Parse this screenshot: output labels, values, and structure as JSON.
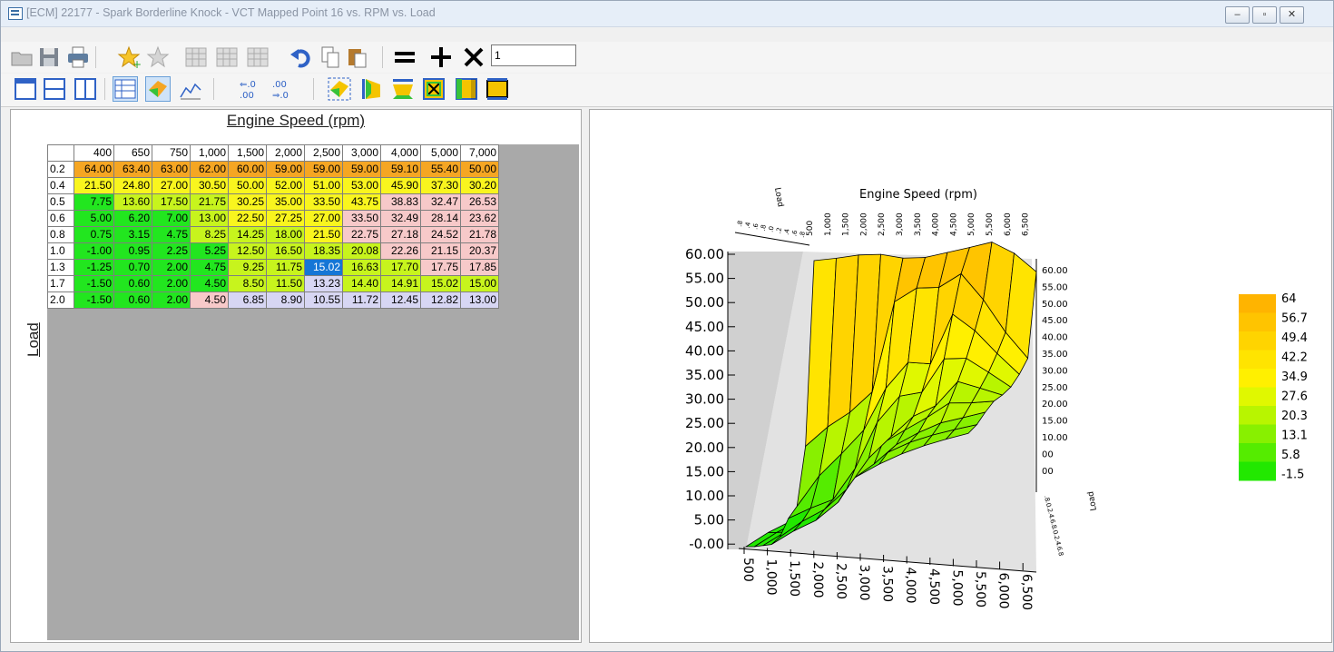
{
  "window": {
    "title": "[ECM] 22177 - Spark Borderline Knock - VCT Mapped Point 16 vs. RPM vs. Load"
  },
  "toolbar": {
    "multiplier_value": "1"
  },
  "table": {
    "x_axis_title": "Engine Speed (rpm)",
    "y_axis_title": "Load",
    "columns": [
      "400",
      "650",
      "750",
      "1,000",
      "1,500",
      "2,000",
      "2,500",
      "3,000",
      "4,000",
      "5,000",
      "7,000"
    ],
    "rows": [
      {
        "label": "0.2",
        "values": [
          "64.00",
          "63.40",
          "63.00",
          "62.00",
          "60.00",
          "59.00",
          "59.00",
          "59.00",
          "59.10",
          "55.40",
          "50.00"
        ]
      },
      {
        "label": "0.4",
        "values": [
          "21.50",
          "24.80",
          "27.00",
          "30.50",
          "50.00",
          "52.00",
          "51.00",
          "53.00",
          "45.90",
          "37.30",
          "30.20"
        ]
      },
      {
        "label": "0.5",
        "values": [
          "7.75",
          "13.60",
          "17.50",
          "21.75",
          "30.25",
          "35.00",
          "33.50",
          "43.75",
          "38.83",
          "32.47",
          "26.53"
        ]
      },
      {
        "label": "0.6",
        "values": [
          "5.00",
          "6.20",
          "7.00",
          "13.00",
          "22.50",
          "27.25",
          "27.00",
          "33.50",
          "32.49",
          "28.14",
          "23.62"
        ]
      },
      {
        "label": "0.8",
        "values": [
          "0.75",
          "3.15",
          "4.75",
          "8.25",
          "14.25",
          "18.00",
          "21.50",
          "22.75",
          "27.18",
          "24.52",
          "21.78"
        ]
      },
      {
        "label": "1.0",
        "values": [
          "-1.00",
          "0.95",
          "2.25",
          "5.25",
          "12.50",
          "16.50",
          "18.35",
          "20.08",
          "22.26",
          "21.15",
          "20.37"
        ]
      },
      {
        "label": "1.3",
        "values": [
          "-1.25",
          "0.70",
          "2.00",
          "4.75",
          "9.25",
          "11.75",
          "15.02",
          "16.63",
          "17.70",
          "17.75",
          "17.85"
        ]
      },
      {
        "label": "1.7",
        "values": [
          "-1.50",
          "0.60",
          "2.00",
          "4.50",
          "8.50",
          "11.50",
          "13.23",
          "14.40",
          "14.91",
          "15.02",
          "15.00"
        ]
      },
      {
        "label": "2.0",
        "values": [
          "-1.50",
          "0.60",
          "2.00",
          "4.50",
          "6.85",
          "8.90",
          "10.55",
          "11.72",
          "12.45",
          "12.82",
          "13.00"
        ]
      }
    ],
    "selected_cell": {
      "row": 6,
      "col": 6
    },
    "colors": {
      "orange": "#f5a623",
      "yellow": "#f9f51e",
      "lime": "#c7f41d",
      "green": "#22e61f",
      "pink": "#f7c9c9",
      "lavender": "#d7d6f3",
      "selected": "#1576d6"
    }
  },
  "chart3d": {
    "x_label": "Engine Speed (rpm)",
    "y_label": "Load",
    "z_ticks": [
      "60.00",
      "55.00",
      "50.00",
      "45.00",
      "40.00",
      "35.00",
      "30.00",
      "25.00",
      "20.00",
      "15.00",
      "10.00",
      "5.00",
      "-0.00"
    ],
    "z_ticks_right": [
      "60.00",
      "55.00",
      "50.00",
      "45.00",
      "40.00",
      "35.00",
      "30.00",
      "25.00",
      "20.00",
      "15.00",
      "10.00",
      "00",
      "00"
    ],
    "x_ticks": [
      "500",
      "1,000",
      "1,500",
      "2,000",
      "2,500",
      "3,000",
      "3,500",
      "4,000",
      "4,500",
      "5,000",
      "5,500",
      "6,000",
      "6,500"
    ],
    "x_ticks_top": [
      "500",
      "1,000",
      "1,500",
      "2,000",
      "2,500",
      "3,000",
      "3,500",
      "4,000",
      "4,500",
      "5,000",
      "5,500",
      "6,000",
      "6,500"
    ],
    "y_ticks_top": [
      ".8",
      ".4",
      ".6",
      ".8",
      ".0",
      ".2",
      ".4",
      ".6",
      ".8"
    ],
    "y_ticks_right": [
      ".8",
      ".0",
      ".2",
      ".4",
      ".6",
      ".8",
      ".0",
      ".2",
      ".4",
      ".6",
      ".8"
    ],
    "legend_values": [
      "64",
      "56.7",
      "49.4",
      "42.2",
      "34.9",
      "27.6",
      "20.3",
      "13.1",
      "5.8",
      "-1.5"
    ],
    "legend_colors": [
      "#ffb400",
      "#ffc400",
      "#ffd400",
      "#ffe400",
      "#fff000",
      "#e0f800",
      "#b8f500",
      "#88f000",
      "#55ec00",
      "#22e800"
    ]
  }
}
